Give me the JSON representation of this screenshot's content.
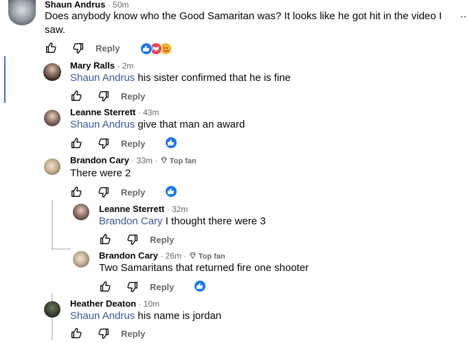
{
  "icons": {
    "like": "thumbs-up-icon",
    "dislike": "thumbs-down-icon",
    "more": "more-icon",
    "diamond": "top-fan-diamond-icon"
  },
  "colors": {
    "mention": "#385898",
    "like_blue": "#1877f2",
    "love_red": "#f33e58",
    "haha_yellow": "#f7b125",
    "meta_gray": "#65676b"
  },
  "comments": [
    {
      "name": "Shaun Andrus",
      "time": "50m",
      "text1": "Does anybody know who the Good Samaritan was? It looks like he got hit in the video I",
      "text2": "saw.",
      "reply": "Reply",
      "more": "··"
    },
    {
      "name": "Mary Ralls",
      "time": "2m",
      "mention": "Shaun Andrus",
      "text": "his sister confirmed that he is fine",
      "reply": "Reply"
    },
    {
      "name": "Leanne Sterrett",
      "time": "43m",
      "mention": "Shaun Andrus",
      "text": "give that man an award",
      "reply": "Reply"
    },
    {
      "name": "Brandon Cary",
      "time": "33m",
      "badge": "Top fan",
      "text": "There were 2",
      "reply": "Reply"
    },
    {
      "name": "Leanne Sterrett",
      "time": "32m",
      "mention": "Brandon Cary",
      "text": "I thought there were 3",
      "reply": "Reply"
    },
    {
      "name": "Brandon Cary",
      "time": "26m",
      "badge": "Top fan",
      "text": "Two Samaritans that returned fire one shooter",
      "reply": "Reply"
    },
    {
      "name": "Heather Deaton",
      "time": "10m",
      "mention": "Shaun Andrus",
      "text": "his name is jordan",
      "reply": "Reply"
    }
  ],
  "sep": "·"
}
